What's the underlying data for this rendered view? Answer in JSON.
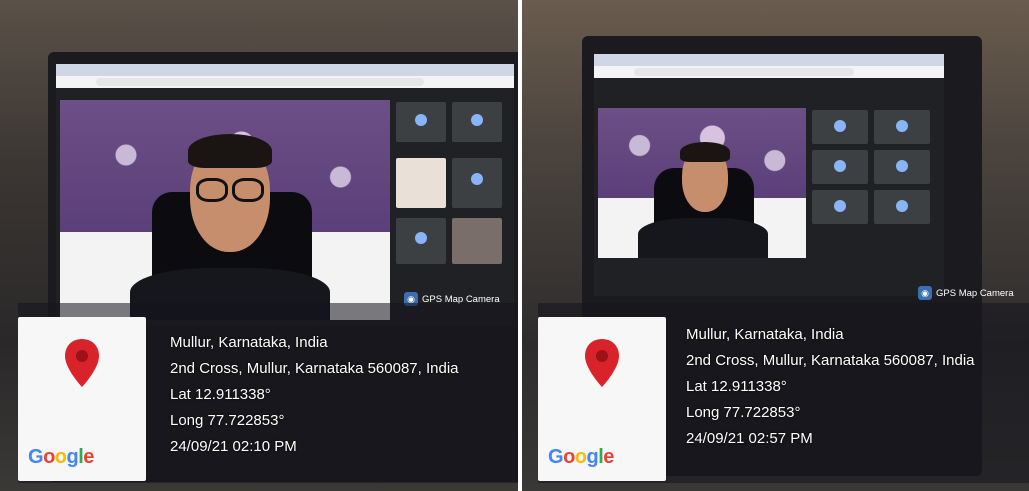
{
  "photos": [
    {
      "id": "left",
      "watermark": "GPS Map Camera",
      "map_logo": "Google",
      "place": "Mullur, Karnataka, India",
      "address": "2nd Cross, Mullur, Karnataka 560087, India",
      "lat": "Lat 12.911338°",
      "long": "Long 77.722853°",
      "datetime": "24/09/21 02:10 PM"
    },
    {
      "id": "right",
      "watermark": "GPS Map Camera",
      "map_logo": "Google",
      "place": "Mullur, Karnataka, India",
      "address": "2nd Cross, Mullur, Karnataka 560087, India",
      "lat": "Lat 12.911338°",
      "long": "Long 77.722853°",
      "datetime": "24/09/21 02:57 PM"
    }
  ],
  "colors": {
    "pin": "#d8232a",
    "google_blue": "#4285f4",
    "google_red": "#ea4335",
    "google_yellow": "#fbbc05",
    "google_green": "#34a853"
  }
}
